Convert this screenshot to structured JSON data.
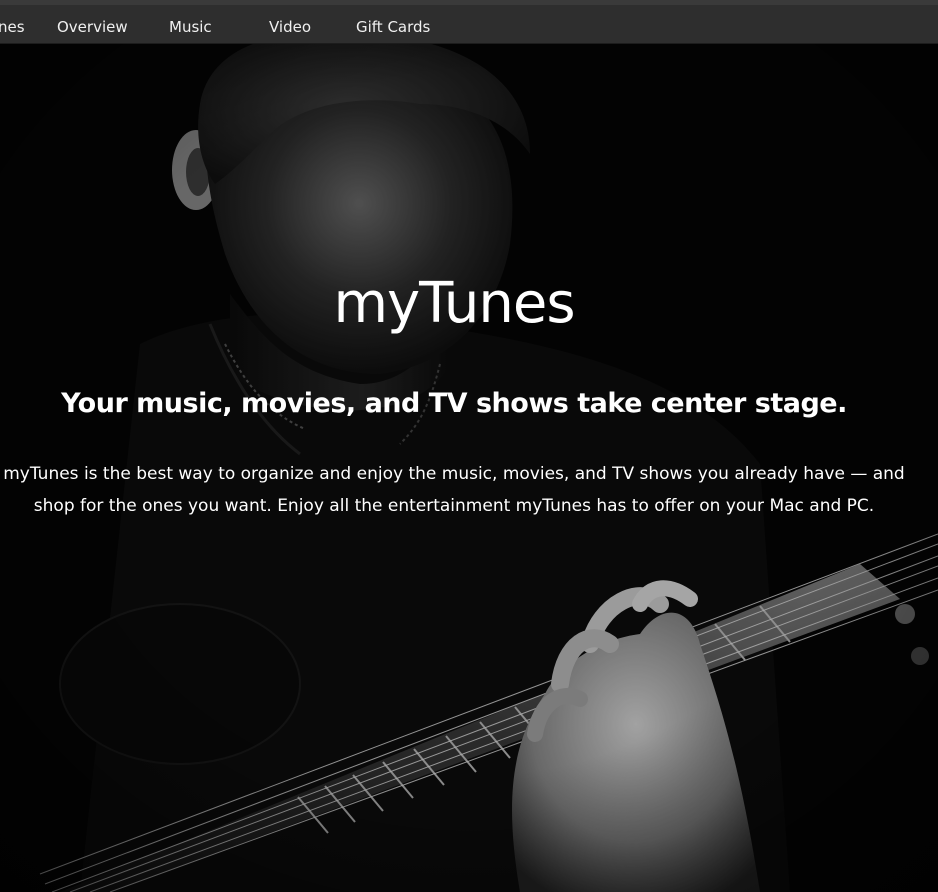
{
  "nav": {
    "items": [
      {
        "label": "nes"
      },
      {
        "label": "Overview"
      },
      {
        "label": "Music"
      },
      {
        "label": "Video"
      },
      {
        "label": "Gift Cards"
      }
    ]
  },
  "hero": {
    "title": "myTunes",
    "subtitle": "Your music, movies, and TV shows take center stage.",
    "description": "myTunes is the best way to organize and enjoy the music, movies, and TV shows you already have — and shop for the ones you want. Enjoy all the entertainment myTunes has to offer on your Mac and PC.",
    "background_image": "man-playing-guitar-photo"
  },
  "colors": {
    "nav_bg": "#2e2e2e",
    "nav_text": "#f0f0f0",
    "hero_bg": "#050505",
    "hero_text": "#ffffff"
  }
}
